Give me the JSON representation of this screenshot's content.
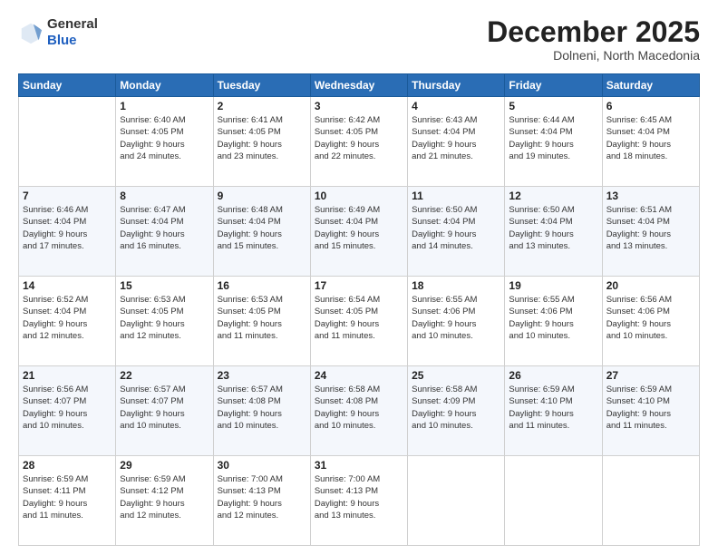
{
  "logo": {
    "general": "General",
    "blue": "Blue"
  },
  "header": {
    "month": "December 2025",
    "location": "Dolneni, North Macedonia"
  },
  "weekdays": [
    "Sunday",
    "Monday",
    "Tuesday",
    "Wednesday",
    "Thursday",
    "Friday",
    "Saturday"
  ],
  "weeks": [
    [
      {
        "day": "",
        "info": ""
      },
      {
        "day": "1",
        "info": "Sunrise: 6:40 AM\nSunset: 4:05 PM\nDaylight: 9 hours\nand 24 minutes."
      },
      {
        "day": "2",
        "info": "Sunrise: 6:41 AM\nSunset: 4:05 PM\nDaylight: 9 hours\nand 23 minutes."
      },
      {
        "day": "3",
        "info": "Sunrise: 6:42 AM\nSunset: 4:05 PM\nDaylight: 9 hours\nand 22 minutes."
      },
      {
        "day": "4",
        "info": "Sunrise: 6:43 AM\nSunset: 4:04 PM\nDaylight: 9 hours\nand 21 minutes."
      },
      {
        "day": "5",
        "info": "Sunrise: 6:44 AM\nSunset: 4:04 PM\nDaylight: 9 hours\nand 19 minutes."
      },
      {
        "day": "6",
        "info": "Sunrise: 6:45 AM\nSunset: 4:04 PM\nDaylight: 9 hours\nand 18 minutes."
      }
    ],
    [
      {
        "day": "7",
        "info": "Sunrise: 6:46 AM\nSunset: 4:04 PM\nDaylight: 9 hours\nand 17 minutes."
      },
      {
        "day": "8",
        "info": "Sunrise: 6:47 AM\nSunset: 4:04 PM\nDaylight: 9 hours\nand 16 minutes."
      },
      {
        "day": "9",
        "info": "Sunrise: 6:48 AM\nSunset: 4:04 PM\nDaylight: 9 hours\nand 15 minutes."
      },
      {
        "day": "10",
        "info": "Sunrise: 6:49 AM\nSunset: 4:04 PM\nDaylight: 9 hours\nand 15 minutes."
      },
      {
        "day": "11",
        "info": "Sunrise: 6:50 AM\nSunset: 4:04 PM\nDaylight: 9 hours\nand 14 minutes."
      },
      {
        "day": "12",
        "info": "Sunrise: 6:50 AM\nSunset: 4:04 PM\nDaylight: 9 hours\nand 13 minutes."
      },
      {
        "day": "13",
        "info": "Sunrise: 6:51 AM\nSunset: 4:04 PM\nDaylight: 9 hours\nand 13 minutes."
      }
    ],
    [
      {
        "day": "14",
        "info": "Sunrise: 6:52 AM\nSunset: 4:04 PM\nDaylight: 9 hours\nand 12 minutes."
      },
      {
        "day": "15",
        "info": "Sunrise: 6:53 AM\nSunset: 4:05 PM\nDaylight: 9 hours\nand 12 minutes."
      },
      {
        "day": "16",
        "info": "Sunrise: 6:53 AM\nSunset: 4:05 PM\nDaylight: 9 hours\nand 11 minutes."
      },
      {
        "day": "17",
        "info": "Sunrise: 6:54 AM\nSunset: 4:05 PM\nDaylight: 9 hours\nand 11 minutes."
      },
      {
        "day": "18",
        "info": "Sunrise: 6:55 AM\nSunset: 4:06 PM\nDaylight: 9 hours\nand 10 minutes."
      },
      {
        "day": "19",
        "info": "Sunrise: 6:55 AM\nSunset: 4:06 PM\nDaylight: 9 hours\nand 10 minutes."
      },
      {
        "day": "20",
        "info": "Sunrise: 6:56 AM\nSunset: 4:06 PM\nDaylight: 9 hours\nand 10 minutes."
      }
    ],
    [
      {
        "day": "21",
        "info": "Sunrise: 6:56 AM\nSunset: 4:07 PM\nDaylight: 9 hours\nand 10 minutes."
      },
      {
        "day": "22",
        "info": "Sunrise: 6:57 AM\nSunset: 4:07 PM\nDaylight: 9 hours\nand 10 minutes."
      },
      {
        "day": "23",
        "info": "Sunrise: 6:57 AM\nSunset: 4:08 PM\nDaylight: 9 hours\nand 10 minutes."
      },
      {
        "day": "24",
        "info": "Sunrise: 6:58 AM\nSunset: 4:08 PM\nDaylight: 9 hours\nand 10 minutes."
      },
      {
        "day": "25",
        "info": "Sunrise: 6:58 AM\nSunset: 4:09 PM\nDaylight: 9 hours\nand 10 minutes."
      },
      {
        "day": "26",
        "info": "Sunrise: 6:59 AM\nSunset: 4:10 PM\nDaylight: 9 hours\nand 11 minutes."
      },
      {
        "day": "27",
        "info": "Sunrise: 6:59 AM\nSunset: 4:10 PM\nDaylight: 9 hours\nand 11 minutes."
      }
    ],
    [
      {
        "day": "28",
        "info": "Sunrise: 6:59 AM\nSunset: 4:11 PM\nDaylight: 9 hours\nand 11 minutes."
      },
      {
        "day": "29",
        "info": "Sunrise: 6:59 AM\nSunset: 4:12 PM\nDaylight: 9 hours\nand 12 minutes."
      },
      {
        "day": "30",
        "info": "Sunrise: 7:00 AM\nSunset: 4:13 PM\nDaylight: 9 hours\nand 12 minutes."
      },
      {
        "day": "31",
        "info": "Sunrise: 7:00 AM\nSunset: 4:13 PM\nDaylight: 9 hours\nand 13 minutes."
      },
      {
        "day": "",
        "info": ""
      },
      {
        "day": "",
        "info": ""
      },
      {
        "day": "",
        "info": ""
      }
    ]
  ]
}
